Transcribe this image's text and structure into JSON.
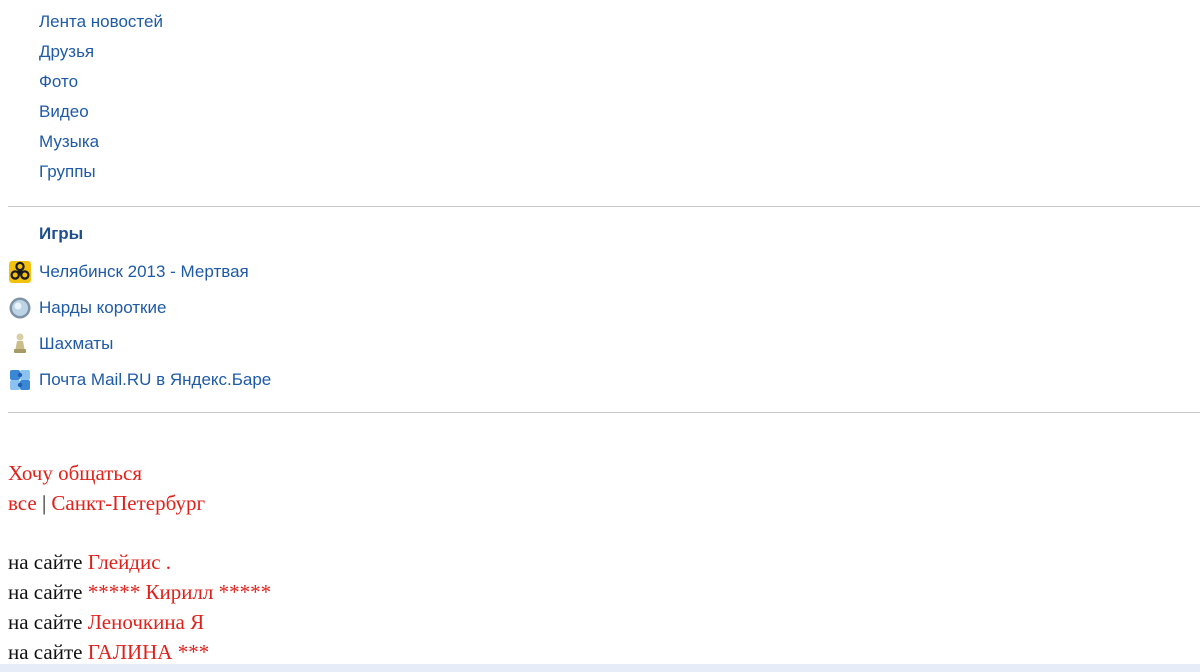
{
  "nav": {
    "items": [
      {
        "label": "Лента новостей"
      },
      {
        "label": "Друзья"
      },
      {
        "label": "Фото"
      },
      {
        "label": "Видео"
      },
      {
        "label": "Музыка"
      },
      {
        "label": "Группы"
      }
    ]
  },
  "games": {
    "heading": "Игры",
    "items": [
      {
        "label": "Челябинск 2013 - Мертвая",
        "icon": "biohazard-icon"
      },
      {
        "label": "Нарды короткие",
        "icon": "globe-icon"
      },
      {
        "label": "Шахматы",
        "icon": "chess-pawn-icon"
      },
      {
        "label": "Почта Mail.RU в Яндекс.Баре",
        "icon": "puzzle-icon"
      }
    ]
  },
  "chat": {
    "title": "Хочу общаться",
    "filter_all": "все",
    "filter_separator": "|",
    "filter_city": "Санкт-Петербург",
    "online_prefix": "на сайте",
    "users": [
      {
        "name": "Глейдис ."
      },
      {
        "name": "***** Кирилл *****"
      },
      {
        "name": "Леночкина Я"
      },
      {
        "name": "ГАЛИНА ***"
      }
    ]
  },
  "colors": {
    "link_blue": "#1f5aa6",
    "heading_blue": "#1f4f8c",
    "accent_red": "#e0211b",
    "divider": "#c8c8c8"
  }
}
